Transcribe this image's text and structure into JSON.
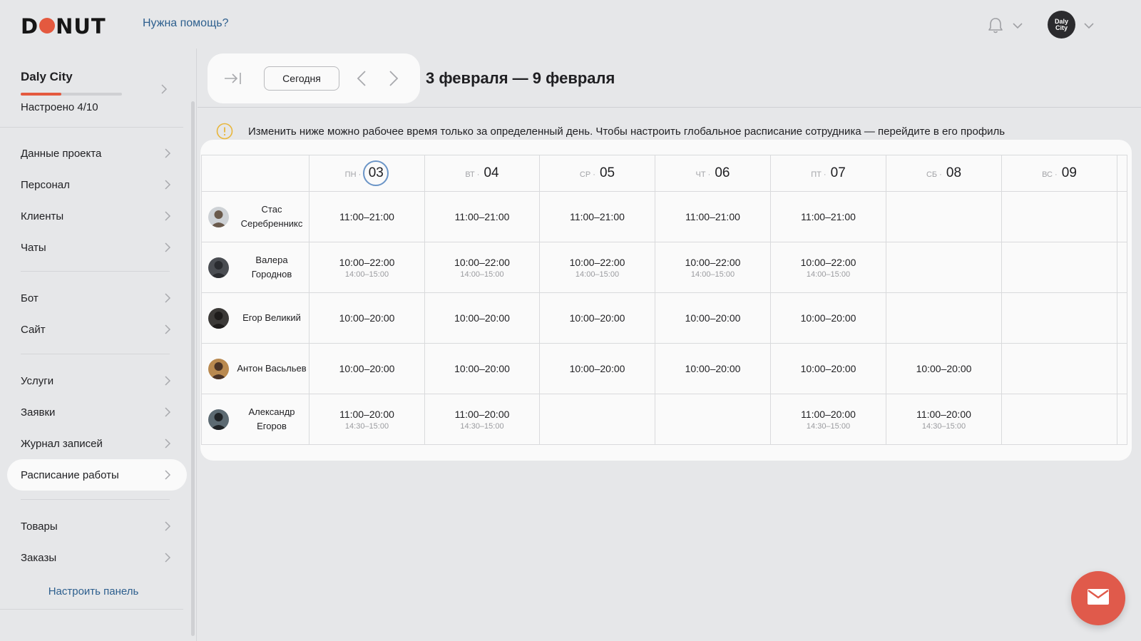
{
  "header": {
    "logo_text": "DONUT",
    "help_link": "Нужна помощь?",
    "avatar_label": "Daly City"
  },
  "sidebar": {
    "project_name": "Daly City",
    "setup_status": "Настроено 4/10",
    "setup_progress": 0.4,
    "groups": [
      [
        "Данные проекта",
        "Персонал",
        "Клиенты",
        "Чаты"
      ],
      [
        "Бот",
        "Сайт"
      ],
      [
        "Услуги",
        "Заявки",
        "Журнал записей",
        "Расписание работы"
      ],
      [
        "Товары",
        "Заказы"
      ]
    ],
    "active_item": "Расписание работы",
    "customize_link": "Настроить панель"
  },
  "toolbar": {
    "today_label": "Сегодня",
    "week_range": "3 февраля — 9 февраля"
  },
  "notice": {
    "text": "Изменить ниже можно рабочее время только за определенный день. Чтобы настроить глобальное расписание сотрудника — перейдите в его профиль"
  },
  "schedule": {
    "days": [
      {
        "abbr": "ПН",
        "num": "03",
        "today": true
      },
      {
        "abbr": "ВТ",
        "num": "04",
        "today": false
      },
      {
        "abbr": "СР",
        "num": "05",
        "today": false
      },
      {
        "abbr": "ЧТ",
        "num": "06",
        "today": false
      },
      {
        "abbr": "ПТ",
        "num": "07",
        "today": false
      },
      {
        "abbr": "СБ",
        "num": "08",
        "today": false
      },
      {
        "abbr": "ВС",
        "num": "09",
        "today": false
      }
    ],
    "employees": [
      {
        "name": "Стас Серебренникс",
        "shifts": [
          {
            "time": "11:00–21:00"
          },
          {
            "time": "11:00–21:00"
          },
          {
            "time": "11:00–21:00"
          },
          {
            "time": "11:00–21:00"
          },
          {
            "time": "11:00–21:00"
          },
          null,
          null
        ]
      },
      {
        "name": "Валера Городнов",
        "shifts": [
          {
            "time": "10:00–22:00",
            "break": "14:00–15:00"
          },
          {
            "time": "10:00–22:00",
            "break": "14:00–15:00"
          },
          {
            "time": "10:00–22:00",
            "break": "14:00–15:00"
          },
          {
            "time": "10:00–22:00",
            "break": "14:00–15:00"
          },
          {
            "time": "10:00–22:00",
            "break": "14:00–15:00"
          },
          null,
          null
        ]
      },
      {
        "name": "Егор Великий",
        "shifts": [
          {
            "time": "10:00–20:00"
          },
          {
            "time": "10:00–20:00"
          },
          {
            "time": "10:00–20:00"
          },
          {
            "time": "10:00–20:00"
          },
          {
            "time": "10:00–20:00"
          },
          null,
          null
        ]
      },
      {
        "name": "Антон Васьльев",
        "shifts": [
          {
            "time": "10:00–20:00"
          },
          {
            "time": "10:00–20:00"
          },
          {
            "time": "10:00–20:00"
          },
          {
            "time": "10:00–20:00"
          },
          {
            "time": "10:00–20:00"
          },
          {
            "time": "10:00–20:00"
          },
          null
        ]
      },
      {
        "name": "Александр Егоров",
        "shifts": [
          {
            "time": "11:00–20:00",
            "break": "14:30–15:00"
          },
          {
            "time": "11:00–20:00",
            "break": "14:30–15:00"
          },
          null,
          null,
          {
            "time": "11:00–20:00",
            "break": "14:30–15:00"
          },
          {
            "time": "11:00–20:00",
            "break": "14:30–15:00"
          },
          null
        ]
      }
    ]
  },
  "colors": {
    "accent": "#e4593f",
    "link": "#2d5f8e",
    "today_ring": "#6b95c7",
    "chat_button": "#e05a4b"
  },
  "icons": {
    "notifications": "bell-icon",
    "chat": "mail-icon",
    "notice": "warning-circle-icon",
    "collapse": "collapse-arrow-icon"
  }
}
